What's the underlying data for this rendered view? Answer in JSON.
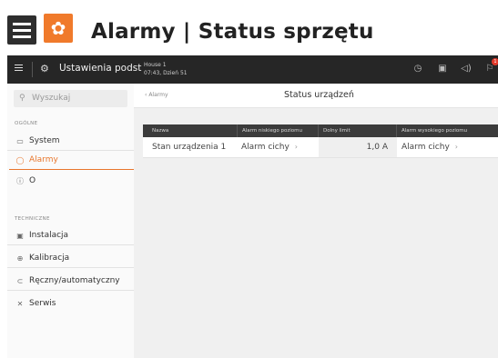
{
  "header": {
    "title": "Alarmy | Status sprzętu",
    "brand_color": "#f07a2b"
  },
  "appbar": {
    "settings_label": "Ustawienia podst",
    "house_name": "House 1",
    "datetime": "07:43, Dzień 51",
    "badge_count": "1"
  },
  "sidebar": {
    "search_placeholder": "Wyszukaj",
    "general_label": "OGÓLNE",
    "technical_label": "TECHNICZNE",
    "items": [
      {
        "label": "System",
        "icon": "monitor-icon"
      },
      {
        "label": "Alarmy",
        "icon": "bell-icon",
        "active": true
      },
      {
        "label": "O",
        "icon": "info-icon"
      },
      {
        "label": "Instalacja",
        "icon": "installation-icon"
      },
      {
        "label": "Kalibracja",
        "icon": "calibration-icon"
      },
      {
        "label": "Ręczny/automatyczny",
        "icon": "manual-auto-icon"
      },
      {
        "label": "Serwis",
        "icon": "wrench-icon"
      }
    ]
  },
  "content": {
    "back_label": "Alarmy",
    "title": "Status urządzeń"
  },
  "table": {
    "columns": [
      "Nazwa",
      "Alarm niskiego poziomu",
      "Dolny limit",
      "Alarm wysokiego poziomu"
    ],
    "rows": [
      {
        "name": "Stan urządzenia 1",
        "low_alarm": "Alarm cichy",
        "lower_limit": "1,0 A",
        "high_alarm": "Alarm cichy"
      }
    ]
  },
  "colors": {
    "accent": "#e8762c",
    "appbar_bg": "#262626",
    "table_header_bg": "#3b3b3b"
  }
}
